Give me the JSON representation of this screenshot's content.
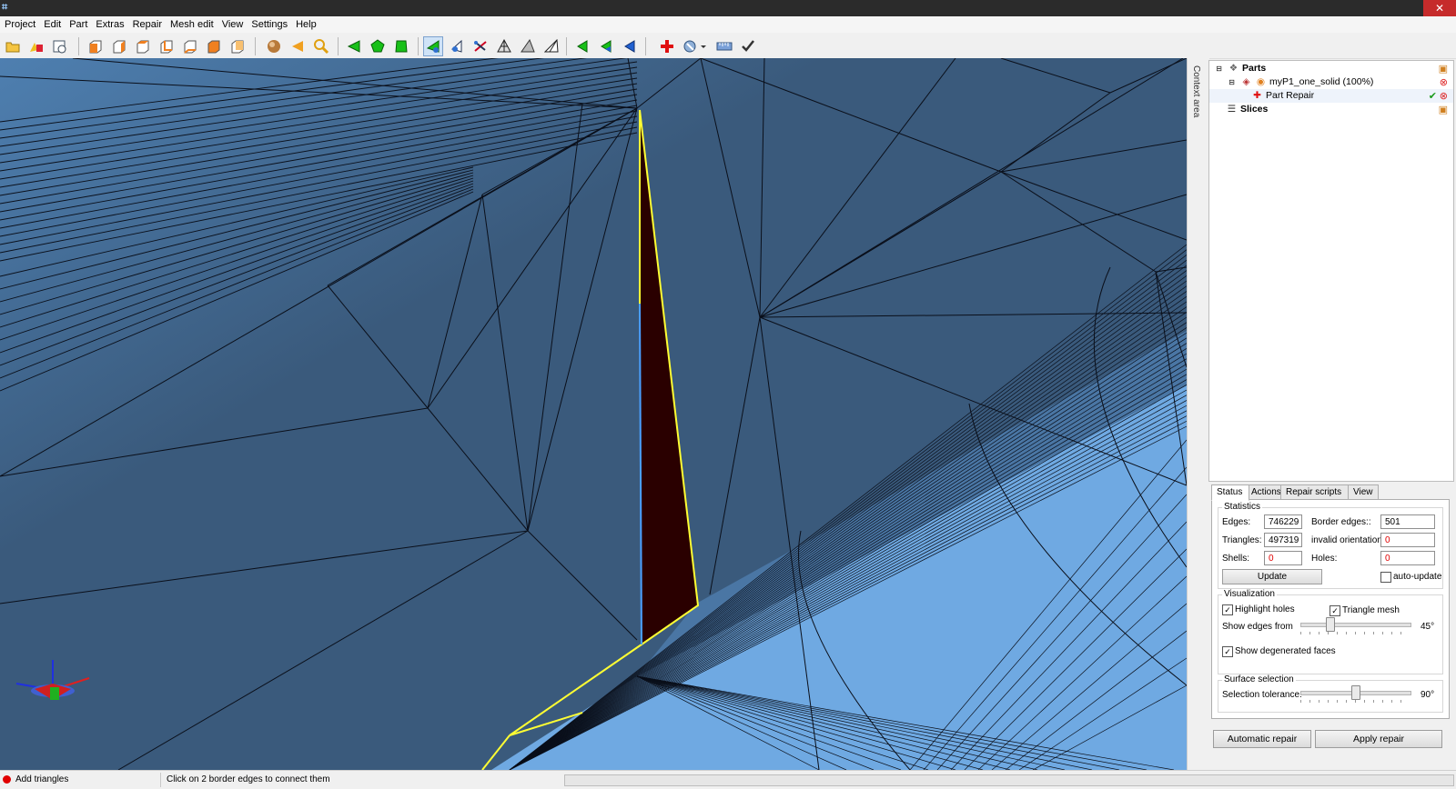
{
  "window": {
    "app_icon": "app-icon",
    "close_glyph": "✕"
  },
  "menu": [
    "Project",
    "Edit",
    "Part",
    "Extras",
    "Repair",
    "Mesh edit",
    "View",
    "Settings",
    "Help"
  ],
  "toolbar_icons": [
    "open-project-icon",
    "add-part-icon",
    "part-info-icon",
    "view-front-icon",
    "view-back-icon",
    "view-left-icon",
    "view-right-icon",
    "view-top-icon",
    "view-bottom-icon",
    "shaded-sphere-icon",
    "triangle-left-icon",
    "zoom-icon",
    "select-triangle-icon",
    "select-surface-icon",
    "select-shell-icon",
    "add-triangles-icon",
    "edit-triangle-icon",
    "cut-icon",
    "wireframe-icon",
    "pyramid-icon",
    "pyramid-outline-icon",
    "triangle-green-icon",
    "triangle-green-blue-icon",
    "triangle-blue-icon",
    "repair-cross-icon",
    "measure-dropdown-icon",
    "ruler-icon",
    "apply-check-icon"
  ],
  "tree": {
    "parts": "Parts",
    "part_name": "myP1_one_solid (100%)",
    "repair": "Part Repair",
    "slices": "Slices"
  },
  "context_area_label": "Context area",
  "tabs": [
    "Status",
    "Actions",
    "Repair scripts",
    "View"
  ],
  "statistics": {
    "title": "Statistics",
    "edges_label": "Edges:",
    "edges": "746229",
    "border_edges_label": "Border edges::",
    "border_edges": "501",
    "triangles_label": "Triangles:",
    "triangles": "497319",
    "invalid_orientation_label": "invalid orientation:",
    "invalid_orientation": "0",
    "shells_label": "Shells:",
    "shells": "0",
    "holes_label": "Holes:",
    "holes": "0",
    "update_button": "Update",
    "auto_update_label": "auto-update"
  },
  "visualization": {
    "title": "Visualization",
    "highlight_holes": "Highlight holes",
    "triangle_mesh": "Triangle mesh",
    "show_edges_label": "Show edges from",
    "show_edges_value": "45°",
    "show_edges_fraction": 0.25,
    "show_degenerated": "Show degenerated faces"
  },
  "surface_selection": {
    "title": "Surface selection",
    "tolerance_label": "Selection tolerance:",
    "tolerance_value": "90°",
    "tolerance_fraction": 0.5
  },
  "buttons": {
    "automatic_repair": "Automatic repair",
    "apply_repair": "Apply repair"
  },
  "status": {
    "mode": "Add triangles",
    "hint": "Click on 2 border edges to connect them"
  },
  "colors": {
    "mesh_dark": "#3a5a7c",
    "mesh_light": "#6fa9e2",
    "highlight_edge": "#ffff33",
    "hole_fill": "#2a0000",
    "status_dot": "#e10000"
  }
}
